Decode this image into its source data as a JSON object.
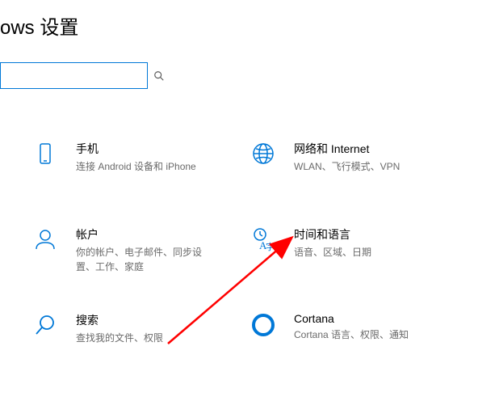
{
  "header": {
    "title": "ows 设置"
  },
  "search": {
    "placeholder": ""
  },
  "tiles": {
    "phone": {
      "title": "手机",
      "sub": "连接 Android 设备和 iPhone"
    },
    "network": {
      "title": "网络和 Internet",
      "sub": "WLAN、飞行模式、VPN"
    },
    "accounts": {
      "title": "帐户",
      "sub": "你的帐户、电子邮件、同步设置、工作、家庭"
    },
    "time": {
      "title": "时间和语言",
      "sub": "语音、区域、日期"
    },
    "search": {
      "title": "搜索",
      "sub": "查找我的文件、权限"
    },
    "cortana": {
      "title": "Cortana",
      "sub": "Cortana 语言、权限、通知"
    }
  }
}
